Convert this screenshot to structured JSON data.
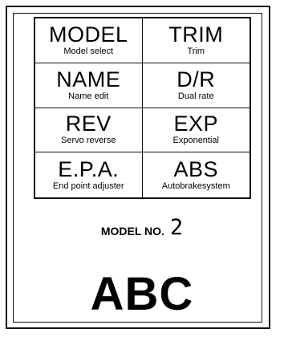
{
  "menu": [
    {
      "code": "MODEL",
      "desc": "Model select"
    },
    {
      "code": "TRIM",
      "desc": "Trim"
    },
    {
      "code": "NAME",
      "desc": "Name edit"
    },
    {
      "code": "D/R",
      "desc": "Dual rate"
    },
    {
      "code": "REV",
      "desc": "Servo reverse"
    },
    {
      "code": "EXP",
      "desc": "Exponential"
    },
    {
      "code": "E.P.A.",
      "desc": "End point adjuster"
    },
    {
      "code": "ABS",
      "desc": "Autobrakesystem"
    }
  ],
  "display": {
    "model_no_label": "MODEL NO.",
    "model_no_value": "2",
    "model_name": "ABC"
  }
}
